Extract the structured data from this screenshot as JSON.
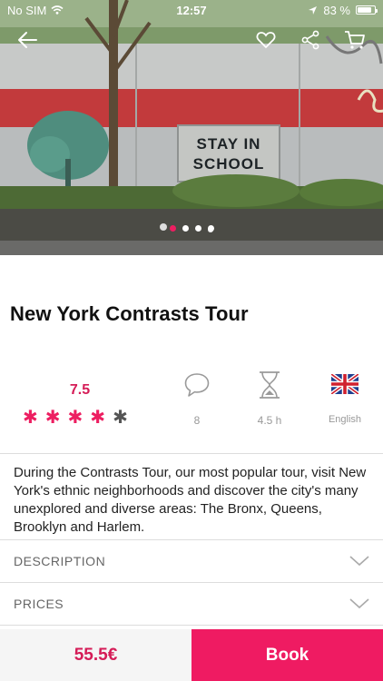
{
  "status_bar": {
    "carrier": "No SIM",
    "time": "12:57",
    "battery": "83 %",
    "battery_level": 0.83
  },
  "hero": {
    "wall_text_line1": "STAY IN",
    "wall_text_line2": "SCHOOL",
    "pages": 4,
    "active_page": 1
  },
  "tour": {
    "title": "New York Contrasts Tour",
    "rating": "7.5",
    "stars_filled": 4,
    "stars_total": 5,
    "comments": "8",
    "duration": "4.5 h",
    "language": "English",
    "description": "During the Contrasts Tour, our most popular tour, visit New York's ethnic neighborhoods and discover the city's many unexplored and diverse areas: The Bronx, Queens, Brooklyn and Harlem."
  },
  "sections": [
    {
      "label": "DESCRIPTION"
    },
    {
      "label": "PRICES"
    }
  ],
  "footer": {
    "price": "55.5€",
    "book_label": "Book"
  },
  "colors": {
    "accent": "#ef1b62",
    "accent_text": "#d51c57"
  },
  "icons": {
    "back": "arrow-left-icon",
    "favorite": "heart-icon",
    "share": "share-icon",
    "cart": "cart-icon",
    "comments": "speech-bubble-icon",
    "duration": "hourglass-icon",
    "language": "uk-flag-icon",
    "expand": "chevron-down-icon"
  }
}
